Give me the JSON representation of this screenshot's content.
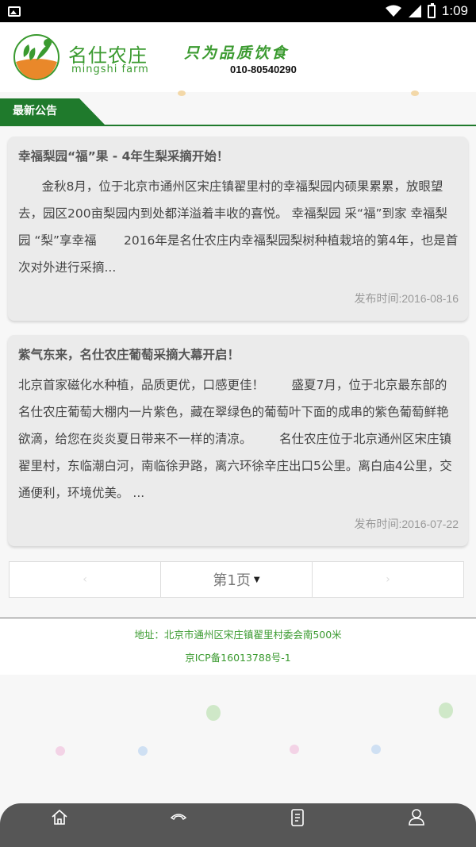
{
  "status_bar": {
    "time": "1:09",
    "icons": [
      "gallery-icon",
      "wifi-icon",
      "signal-icon",
      "battery-charging-icon"
    ]
  },
  "header": {
    "brand_name": "名仕农庄",
    "brand_sub": "mingshi farm",
    "slogan": "只为品质饮食",
    "phone": "010-80540290"
  },
  "section": {
    "title": "最新公告"
  },
  "articles": [
    {
      "title": "幸福梨园“福”果 - 4年生梨采摘开始！",
      "body": "      金秋8月，位于北京市通州区宋庄镇翟里村的幸福梨园内硕果累累，放眼望去，园区200亩梨园内到处都洋溢着丰收的喜悦。 幸福梨园 采“福”到家 幸福梨园 “梨”享幸福       2016年是名仕农庄内幸福梨园梨树种植栽培的第4年，也是首次对外进行采摘...",
      "date": "发布时间:2016-08-16"
    },
    {
      "title": "紫气东来，名仕农庄葡萄采摘大幕开启！",
      "body": "北京首家磁化水种植，品质更优，口感更佳！       盛夏7月，位于北京最东部的名仕农庄葡萄大棚内一片紫色，藏在翠绿色的葡萄叶下面的成串的紫色葡萄鲜艳欲滴，给您在炎炎夏日带来不一样的清凉。       名仕农庄位于北京通州区宋庄镇翟里村，东临潮白河，南临徐尹路，离六环徐辛庄出口5公里。离白庙4公里，交通便利，环境优美。 ...",
      "date": "发布时间:2016-07-22"
    }
  ],
  "pager": {
    "prev": "‹",
    "current": "第1页",
    "next": "›"
  },
  "footer": {
    "address": "地址：北京市通州区宋庄镇翟里村委会南500米",
    "icp": "京ICP备16013788号-1"
  },
  "bottom_nav": [
    {
      "icon": "home-icon"
    },
    {
      "icon": "phone-icon"
    },
    {
      "icon": "notebook-icon"
    },
    {
      "icon": "user-icon"
    }
  ],
  "colors": {
    "brand_green": "#3a9a2f",
    "section_green": "#1f7a2c",
    "card_bg": "#ebebeb",
    "nav_bg": "#565656"
  }
}
